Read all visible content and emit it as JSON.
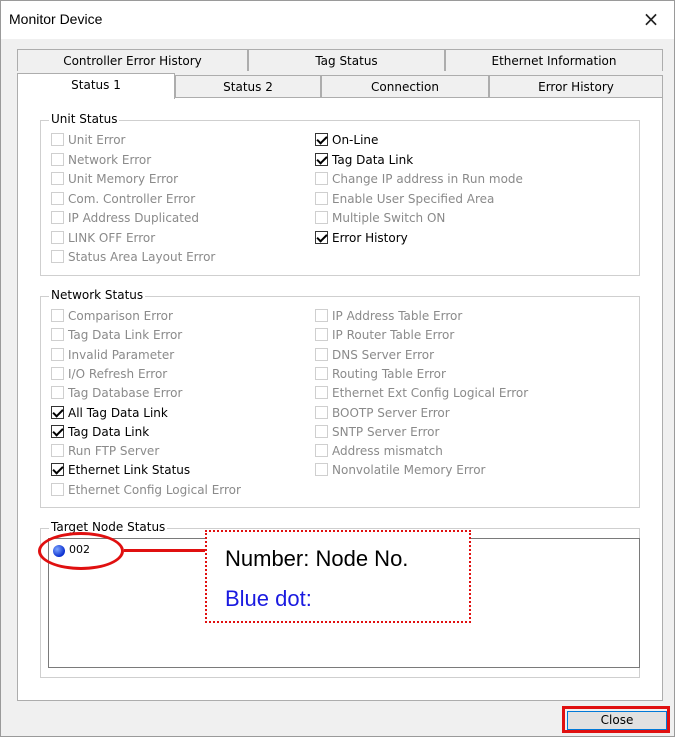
{
  "window": {
    "title": "Monitor Device",
    "close_glyph": "×"
  },
  "tabs_row1": [
    "Controller Error History",
    "Tag Status",
    "Ethernet Information"
  ],
  "tabs_row2": [
    "Status 1",
    "Status 2",
    "Connection",
    "Error History"
  ],
  "active_tab": "Status 1",
  "unit_status": {
    "label": "Unit Status",
    "left": [
      {
        "label": "Unit Error",
        "checked": false
      },
      {
        "label": "Network Error",
        "checked": false
      },
      {
        "label": "Unit Memory Error",
        "checked": false
      },
      {
        "label": "Com. Controller Error",
        "checked": false
      },
      {
        "label": "IP Address Duplicated",
        "checked": false
      },
      {
        "label": "LINK OFF Error",
        "checked": false
      },
      {
        "label": "Status Area Layout Error",
        "checked": false
      }
    ],
    "right": [
      {
        "label": "On-Line",
        "checked": true
      },
      {
        "label": "Tag Data Link",
        "checked": true
      },
      {
        "label": "Change IP address in Run mode",
        "checked": false
      },
      {
        "label": "Enable User Specified Area",
        "checked": false
      },
      {
        "label": "Multiple Switch ON",
        "checked": false
      },
      {
        "label": "Error History",
        "checked": true
      }
    ]
  },
  "network_status": {
    "label": "Network Status",
    "left": [
      {
        "label": "Comparison Error",
        "checked": false
      },
      {
        "label": "Tag Data Link Error",
        "checked": false
      },
      {
        "label": "Invalid Parameter",
        "checked": false
      },
      {
        "label": "I/O Refresh Error",
        "checked": false
      },
      {
        "label": "Tag Database Error",
        "checked": false
      },
      {
        "label": "All Tag Data Link",
        "checked": true
      },
      {
        "label": "Tag Data Link",
        "checked": true
      },
      {
        "label": "Run FTP Server",
        "checked": false
      },
      {
        "label": "Ethernet Link Status",
        "checked": true
      },
      {
        "label": "Ethernet Config Logical Error",
        "checked": false
      }
    ],
    "right": [
      {
        "label": "IP Address Table Error",
        "checked": false
      },
      {
        "label": "IP Router Table Error",
        "checked": false
      },
      {
        "label": "DNS Server Error",
        "checked": false
      },
      {
        "label": "Routing Table Error",
        "checked": false
      },
      {
        "label": "Ethernet Ext Config Logical Error",
        "checked": false
      },
      {
        "label": "BOOTP Server Error",
        "checked": false
      },
      {
        "label": "SNTP Server Error",
        "checked": false
      },
      {
        "label": "Address mismatch",
        "checked": false
      },
      {
        "label": "Nonvolatile Memory Error",
        "checked": false
      }
    ]
  },
  "target_node": {
    "label": "Target Node Status",
    "nodes": [
      {
        "number": "002",
        "color": "#1030e0"
      }
    ]
  },
  "annotation": {
    "line1": "Number: Node No.",
    "line2": "Blue dot:",
    "color": "#e01010",
    "text2_color": "#1a1ae0"
  },
  "footer": {
    "close_label": "Close"
  }
}
